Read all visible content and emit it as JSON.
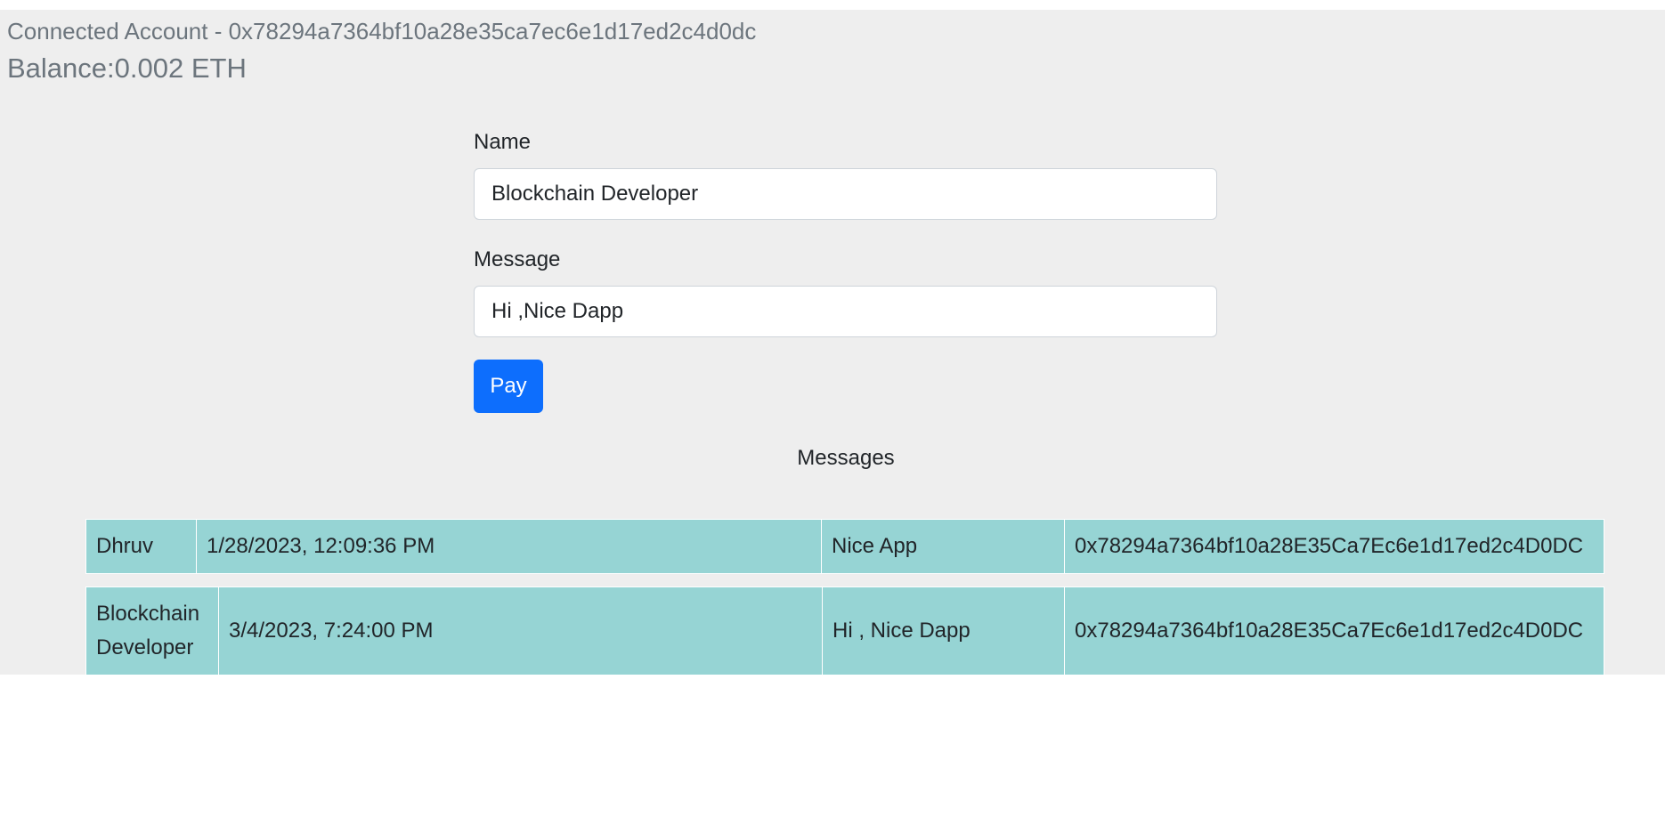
{
  "header": {
    "connected_account": "Connected Account - 0x78294a7364bf10a28e35ca7ec6e1d17ed2c4d0dc",
    "balance": "Balance:0.002 ETH"
  },
  "form": {
    "name_label": "Name",
    "name_value": "Blockchain Developer",
    "message_label": "Message",
    "message_value": "Hi ,Nice Dapp",
    "pay_label": "Pay"
  },
  "messages": {
    "title": "Messages",
    "rows": [
      {
        "name": "Dhruv",
        "timestamp": "1/28/2023, 12:09:36 PM",
        "message": "Nice App",
        "from": "0x78294a7364bf10a28E35Ca7Ec6e1d17ed2c4D0DC"
      },
      {
        "name": "Blockchain Developer",
        "timestamp": "3/4/2023, 7:24:00 PM",
        "message": "Hi , Nice Dapp",
        "from": "0x78294a7364bf10a28E35Ca7Ec6e1d17ed2c4D0DC"
      }
    ]
  },
  "colors": {
    "page_background": "#eeeeee",
    "row_background": "#96d4d4",
    "primary_button": "#0d6efd",
    "muted_text": "#6c757d"
  }
}
